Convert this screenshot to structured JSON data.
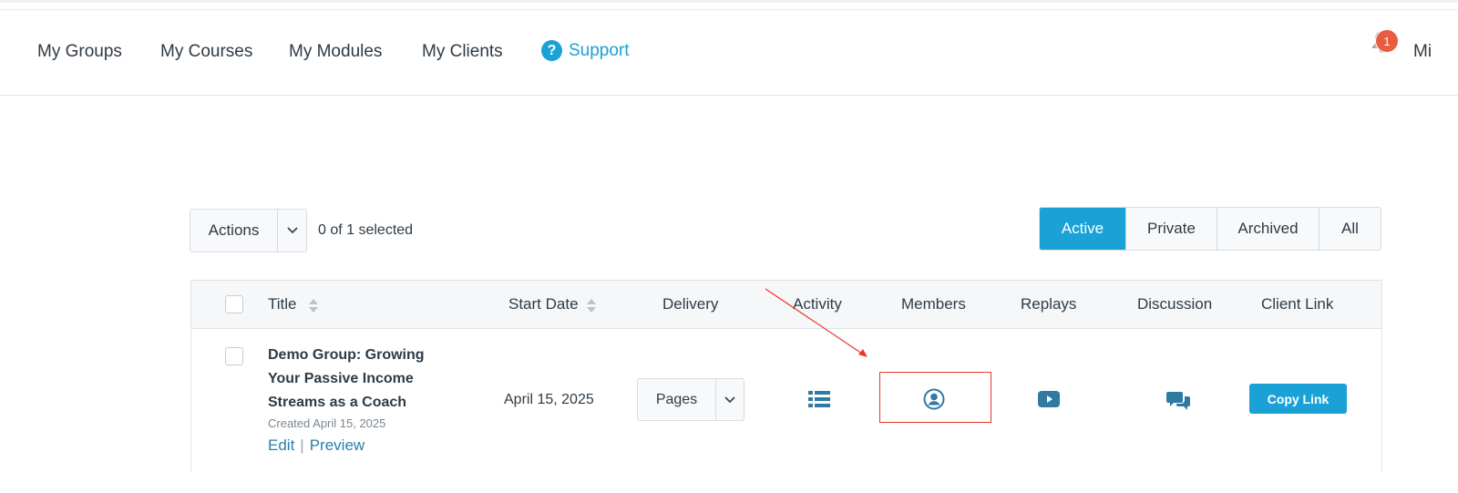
{
  "nav": {
    "items": [
      {
        "label": "My Groups"
      },
      {
        "label": "My Courses"
      },
      {
        "label": "My Modules"
      },
      {
        "label": "My Clients"
      }
    ],
    "support_label": "Support",
    "notification_count": "1",
    "user_name_partial": "Mi"
  },
  "toolbar": {
    "actions_label": "Actions",
    "selected_text": "0 of 1 selected",
    "filters": [
      {
        "label": "Active",
        "active": true
      },
      {
        "label": "Private",
        "active": false
      },
      {
        "label": "Archived",
        "active": false
      },
      {
        "label": "All",
        "active": false
      }
    ]
  },
  "table": {
    "headers": {
      "title": "Title",
      "start_date": "Start Date",
      "delivery": "Delivery",
      "activity": "Activity",
      "members": "Members",
      "replays": "Replays",
      "discussion": "Discussion",
      "client_link": "Client Link"
    },
    "rows": [
      {
        "title": "Demo Group: Growing Your Passive Income Streams as a Coach",
        "created": "Created April 15, 2025",
        "edit_label": "Edit",
        "preview_label": "Preview",
        "start_date": "April 15, 2025",
        "delivery": "Pages",
        "copy_link_label": "Copy Link"
      }
    ]
  },
  "colors": {
    "accent": "#1aa1d6",
    "icon": "#2e7aa3",
    "badge": "#e85c3f",
    "annotation": "#e8372a"
  }
}
